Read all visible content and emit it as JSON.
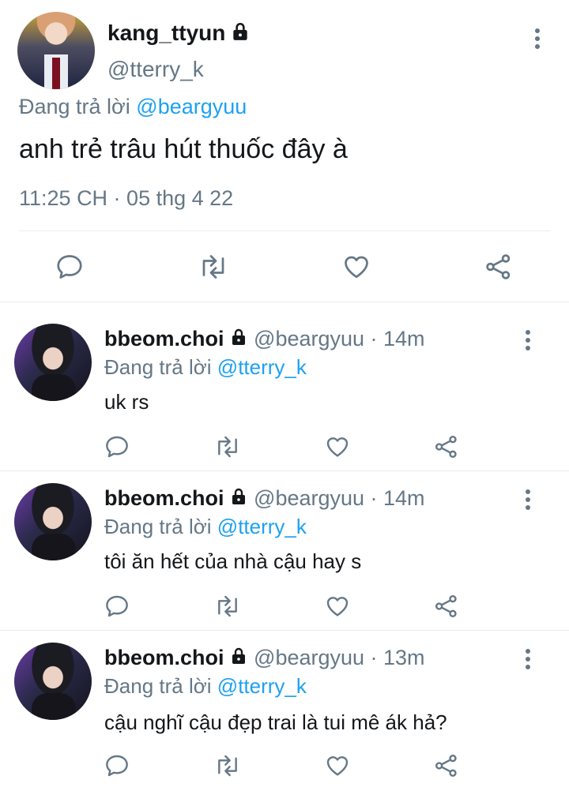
{
  "main_tweet": {
    "display_name": "kang_ttyun",
    "handle": "@tterry_k",
    "replying_prefix": "Đang trả lời",
    "replying_to": "@beargyuu",
    "text": "anh trẻ trâu hút thuốc đây à",
    "timestamp": "11:25 CH · 05 thg 4 22",
    "icons": [
      "lock-icon",
      "more-vertical-icon",
      "reply-icon",
      "retweet-icon",
      "like-icon",
      "share-icon"
    ]
  },
  "replies": [
    {
      "display_name": "bbeom.choi",
      "handle_time": "@beargyuu · 14m",
      "replying_prefix": "Đang trả lời",
      "replying_to": "@tterry_k",
      "text": "uk rs"
    },
    {
      "display_name": "bbeom.choi",
      "handle_time": "@beargyuu · 14m",
      "replying_prefix": "Đang trả lời",
      "replying_to": "@tterry_k",
      "text": "tôi ăn hết của nhà cậu hay s"
    },
    {
      "display_name": "bbeom.choi",
      "handle_time": "@beargyuu · 13m",
      "replying_prefix": "Đang trả lời",
      "replying_to": "@tterry_k",
      "text": "cậu nghĩ cậu đẹp trai là tui mê ák hả?"
    }
  ],
  "colors": {
    "link": "#1da1f2",
    "muted": "#657786",
    "divider": "#e6ecf0",
    "text": "#14171a"
  }
}
